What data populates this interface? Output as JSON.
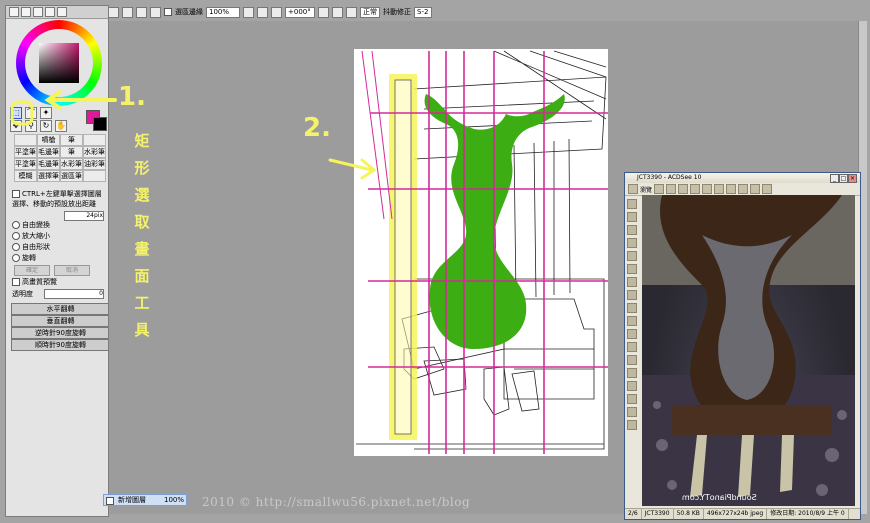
{
  "toolbar": {
    "selection_edge_label": "選區邊緣",
    "zoom": "100%",
    "rotation": "+000°",
    "mode": "正常",
    "stabilizer_label": "抖動修正",
    "stabilizer_value": "S-2"
  },
  "tool_panel": {
    "brushes": [
      "",
      "噴槍",
      "筆",
      "",
      "平塗筆",
      "毛邊筆",
      "筆",
      "水彩筆",
      "",
      "",
      "",
      "",
      "",
      "",
      "",
      "",
      "油彩筆",
      "模糊",
      "選擇筆",
      "選區筆"
    ],
    "brush_row_labels": [
      "平塗筆",
      "毛邊筆",
      "水彩筆",
      "油彩筆",
      "模糊",
      "選擇筆",
      "選區筆"
    ],
    "ctrl_option": "CTRL+左鍵單擊選擇圖層",
    "move_option": "選擇、移動的預設放出距離",
    "px_value": "24pix",
    "transform_options": [
      "自由變換",
      "放大縮小",
      "自由形狀",
      "旋轉"
    ],
    "cancel_label": "確定",
    "ok_label": "取消",
    "hq_option": "高畫質預覽",
    "opacity_label": "透明度",
    "opacity_value": "0",
    "action_buttons": [
      "水平翻轉",
      "垂直翻轉",
      "逆時針90度旋轉",
      "順時針90度旋轉"
    ]
  },
  "layer": {
    "name": "新增圖層",
    "opacity": "100%"
  },
  "annotations": {
    "one": "1.",
    "two": "2.",
    "vertical_text": [
      "矩",
      "形",
      "選",
      "取",
      "畫",
      "面",
      "工",
      "具"
    ]
  },
  "watermark": "2010 © http://smallwu56.pixnet.net/blog",
  "acdsee": {
    "title": "JCT3390 - ACDSee 10",
    "view_label": "瀏覽",
    "photo_watermark": "SoundPianoTY.com",
    "status": [
      "2/6",
      "JCT3390",
      "50.8 KB",
      "496x727x24b jpeg",
      "修改日期: 2010/8/9 上午 0"
    ]
  },
  "colors": {
    "accent_magenta": "#e0189a",
    "harp_green": "#3cad12",
    "highlight_yellow": "#f5f55a",
    "guide_magenta": "#d42a9a"
  }
}
